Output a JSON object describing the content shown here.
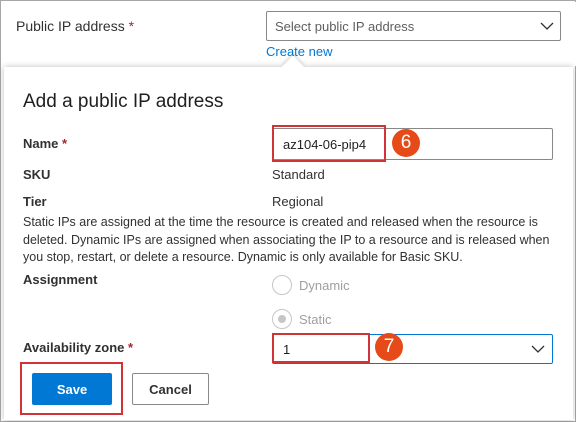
{
  "top": {
    "public_ip_label": "Public IP address",
    "required_mark": "*",
    "select_placeholder": "Select public IP address",
    "create_new": "Create new"
  },
  "panel": {
    "title": "Add a public IP address",
    "name_label": "Name",
    "name_value": "az104-06-pip4",
    "sku_label": "SKU",
    "sku_value": "Standard",
    "tier_label": "Tier",
    "tier_value": "Regional",
    "description": "Static IPs are assigned at the time the resource is created and released when the resource is deleted. Dynamic IPs are assigned when associating the IP to a resource and is released when you stop, restart, or delete a resource. Dynamic is only available for Basic SKU.",
    "assignment_label": "Assignment",
    "assignment_options": [
      "Dynamic",
      "Static"
    ],
    "assignment_selected": "Static",
    "az_label": "Availability zone",
    "az_value": "1",
    "save_label": "Save",
    "cancel_label": "Cancel"
  },
  "annotations": {
    "step_name": "6",
    "step_az": "7"
  },
  "colors": {
    "accent": "#0078d4",
    "highlight": "#d13438",
    "badge": "#e64a19"
  },
  "icons": {
    "select_chevron": "chevron-down-icon"
  }
}
